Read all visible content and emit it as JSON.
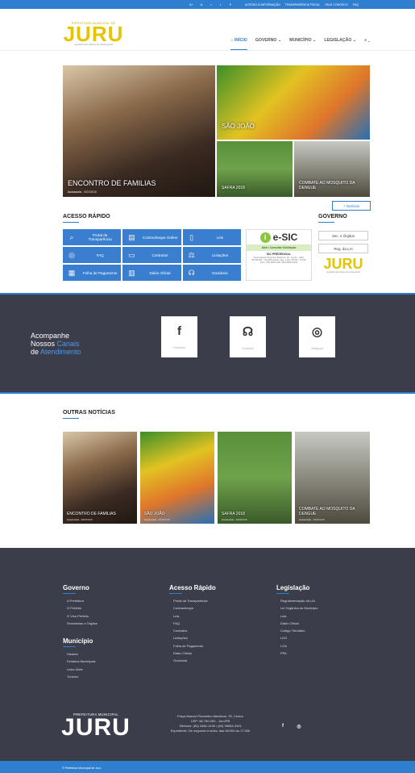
{
  "topbar": {
    "tools": [
      "A+",
      "A-",
      "◐",
      "◑",
      "♿"
    ],
    "links": [
      "ACESSO À INFORMAÇÃO",
      "TRANSPARÊNCIA FISCAL",
      "FALE CONOSCO",
      "FAQ"
    ]
  },
  "logo": {
    "prefix": "PREFEITURA MUNICIPAL DE",
    "name": "JURU",
    "tagline": "A gestão dos braços de nossa gente"
  },
  "nav": {
    "items": [
      "INÍCIO",
      "GOVERNO",
      "MUNICÍPIO",
      "LEGISLAÇÃO"
    ],
    "chevron": "⌄",
    "search_icon": "🔍"
  },
  "hero": {
    "main": {
      "caption": "ENCONTRO DE FAMILIAS",
      "author": "Assessoria",
      "date": "30/03/2018"
    },
    "tiles": [
      {
        "caption": "SÃO JOÃO"
      },
      {
        "caption": "SAFRA 2018"
      },
      {
        "caption": "COMBATE AO MOSQUITO DA DENGUE"
      }
    ],
    "more_button": "+ Notícias"
  },
  "quick_access": {
    "title": "ACESSO RÁPIDO",
    "items": [
      {
        "icon": "magnifier-icon",
        "glyph": "⌕",
        "label": "Portal da Transparência"
      },
      {
        "icon": "paycheck-icon",
        "glyph": "▤",
        "label": "Contracheque Online"
      },
      {
        "icon": "document-icon",
        "glyph": "▯",
        "label": "Leis"
      },
      {
        "icon": "chat-icon",
        "glyph": "◎",
        "label": "FAQ"
      },
      {
        "icon": "contract-icon",
        "glyph": "▭",
        "label": "Contratos"
      },
      {
        "icon": "gavel-icon",
        "glyph": "⚖",
        "label": "Licitações"
      },
      {
        "icon": "payroll-icon",
        "glyph": "▦",
        "label": "Folha de Pagamento"
      },
      {
        "icon": "book-icon",
        "glyph": "▥",
        "label": "Diário Oficial"
      },
      {
        "icon": "headset-icon",
        "glyph": "☊",
        "label": "Ouvidoria"
      }
    ]
  },
  "esic": {
    "brand": "e-SIC",
    "link": "Abrir / Consultar Solicitação",
    "subtitle": "SIC PRESENCIAL",
    "details": "Praça Manoel Florentino Medeiros, 29 - Centro - CEP: 58.750-000 - Juru/PB Horário: Seg. à Sex. 08:00h - 17:00h Fone: (83) 3484-1245 / (83) 99654-3341"
  },
  "governo": {
    "title": "GOVERNO",
    "buttons": [
      "Sec. e Órgãos",
      "Reg. da LAI"
    ]
  },
  "channels": {
    "line1": "Acompanhe",
    "line2_a": "Nossos ",
    "line2_b": "Canais",
    "line3_a": "de ",
    "line3_b": "Atendimento",
    "items": [
      {
        "icon": "facebook-icon",
        "glyph": "f",
        "label": "Facebook"
      },
      {
        "icon": "headset-icon",
        "glyph": "☊",
        "label": "Ouvidoria"
      },
      {
        "icon": "instagram-icon",
        "glyph": "◎",
        "label": "Instagram"
      }
    ]
  },
  "other_news": {
    "title": "OUTRAS NOTÍCIAS",
    "items": [
      {
        "caption": "ENCONTRO DE FAMILIAS",
        "author": "Assessoria",
        "date": "30/03/2018"
      },
      {
        "caption": "SÃO JOÃO",
        "author": "Assessoria",
        "date": "29/03/2018"
      },
      {
        "caption": "SAFRA 2018",
        "author": "Assessoria",
        "date": "29/03/2018"
      },
      {
        "caption": "COMBATE AO MOSQUITO DA DENGUE",
        "author": "Assessoria",
        "date": "29/03/2018"
      }
    ]
  },
  "footer": {
    "governo": {
      "title": "Governo",
      "items": [
        "A Prefeitura",
        "O Prefeito",
        "O Vice-Prefeito",
        "Secretarias e Órgãos"
      ]
    },
    "municipio": {
      "title": "Município",
      "items": [
        "História",
        "Feriados Municipais",
        "Links Úteis",
        "Turismo"
      ]
    },
    "acesso": {
      "title": "Acesso Rápido",
      "items": [
        "Portal da Transparência",
        "Contracheque",
        "Leis",
        "FAQ",
        "Contratos",
        "Licitações",
        "Folha de Pagamento",
        "Diário Oficial",
        "Ouvidoria"
      ]
    },
    "legislacao": {
      "title": "Legislação",
      "items": [
        "Regulamentação da LAI",
        "Lei Orgânica do Município",
        "Leis",
        "Diário Oficial",
        "Código Tributário",
        "LDO",
        "LOA",
        "PPA"
      ]
    },
    "logo_prefix": "PREFEITURA MUNICIPAL",
    "logo_name": "JURU",
    "address": [
      "Praça Manoel Florentino Medeiros, 29, Centro",
      "CEP: 58.750-000 - Juru/PB",
      "Telefone: (83) 3484-1245 / (83) 99654-3341",
      "Expediente: De segunda à sexta, das 08:00h às 17:00h"
    ],
    "social": [
      {
        "icon": "facebook-icon",
        "glyph": "f"
      },
      {
        "icon": "instagram-icon",
        "glyph": "◎"
      }
    ],
    "copyright": "© Prefeitura Municipal de Juru"
  }
}
